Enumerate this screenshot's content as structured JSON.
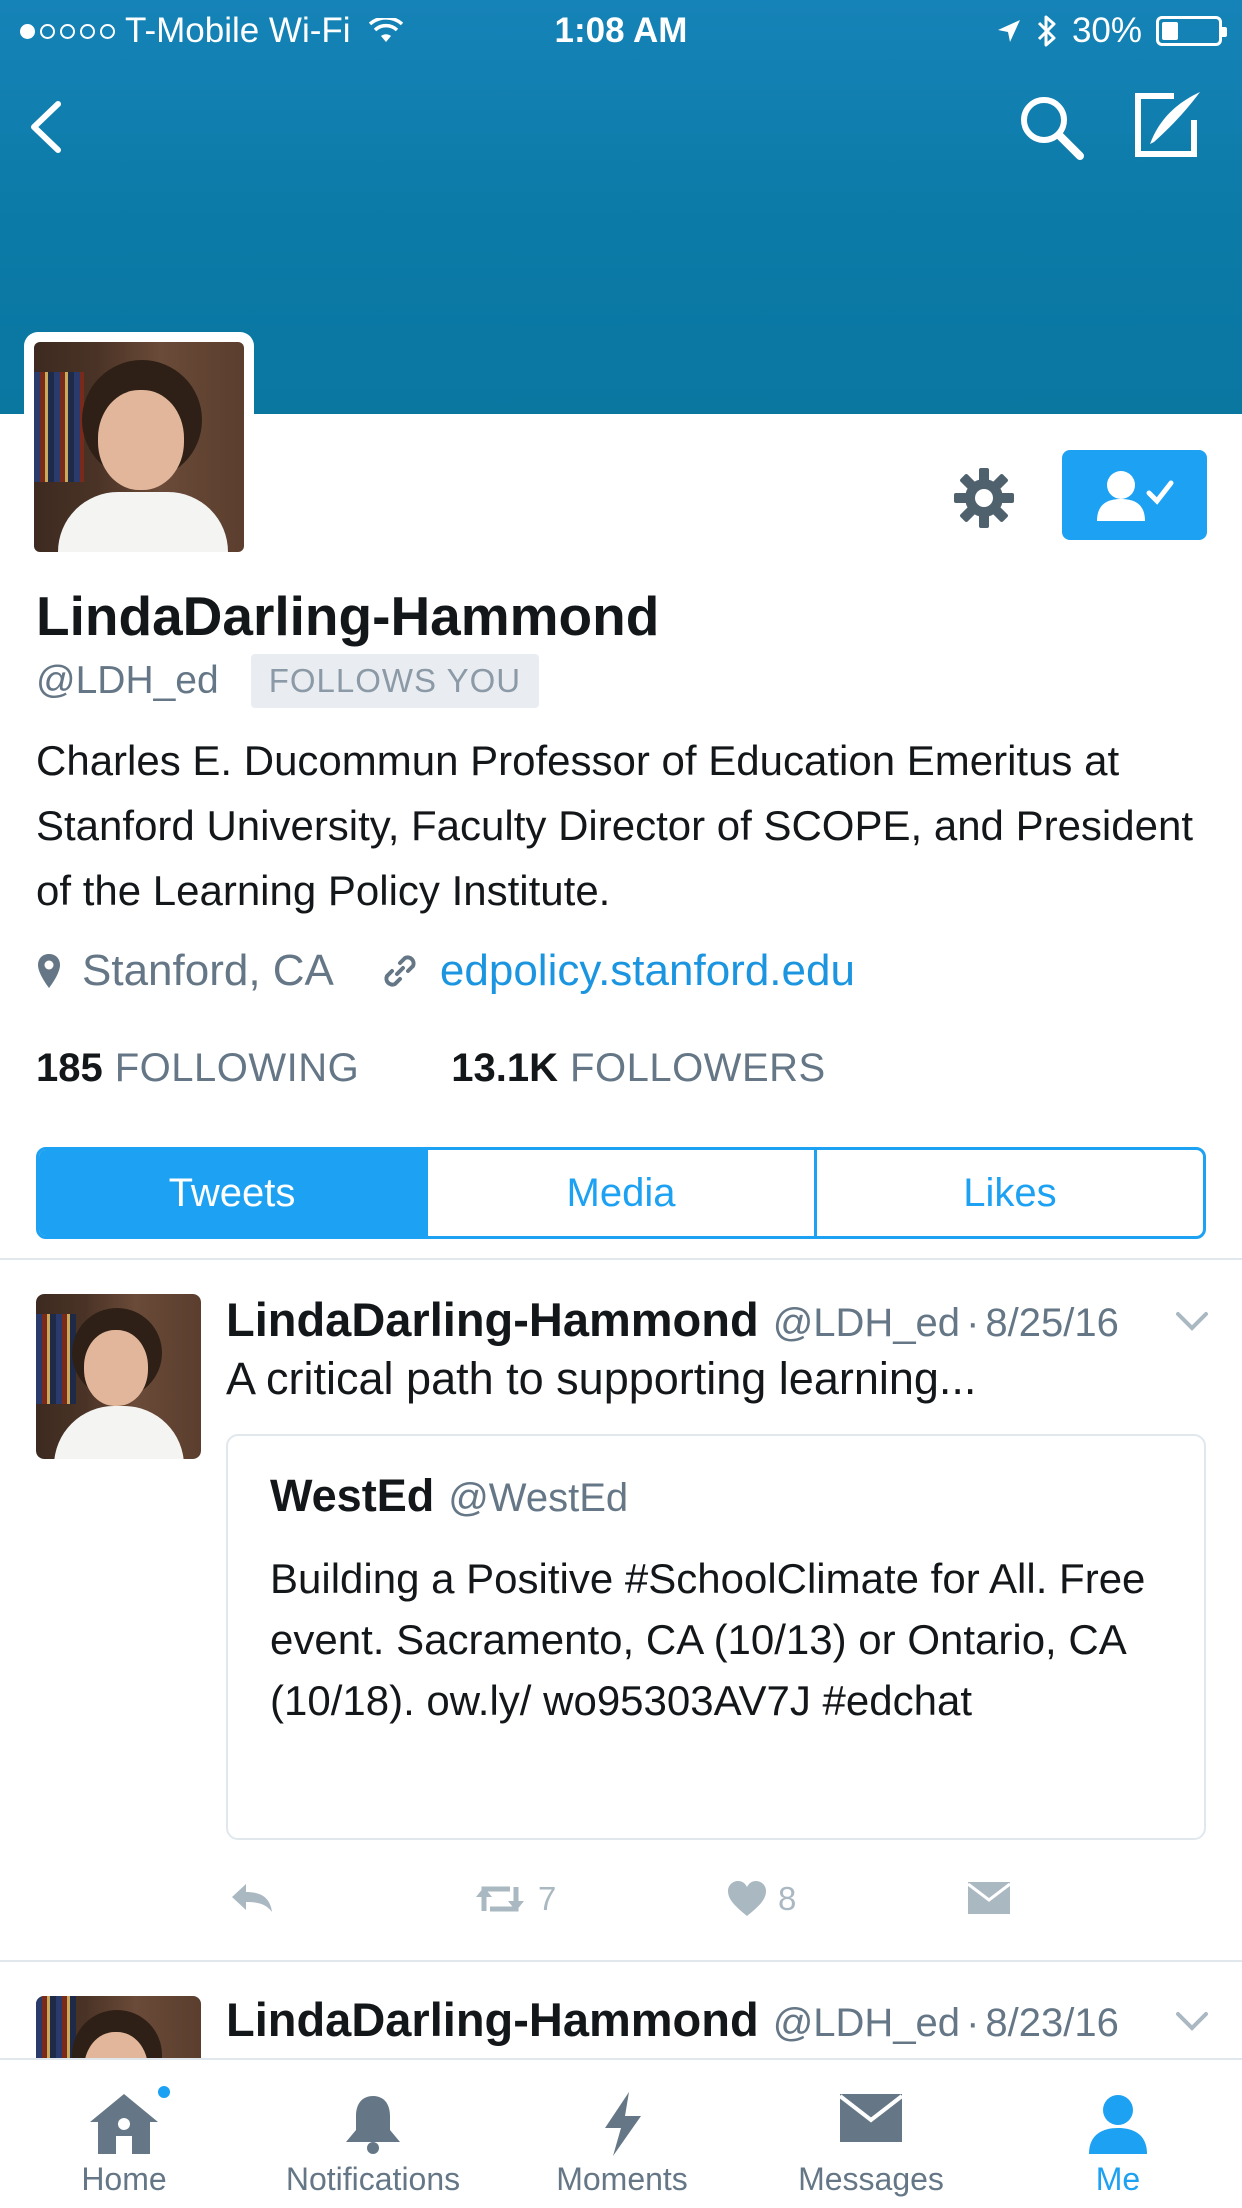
{
  "status_bar": {
    "carrier": "T-Mobile Wi-Fi",
    "time": "1:08 AM",
    "battery": "30%",
    "battery_level": 0.3,
    "signal_bars_filled": 1,
    "signal_bars_total": 5
  },
  "nav": {
    "back_icon": "chevron-left-icon",
    "search_icon": "search-icon",
    "compose_icon": "compose-icon"
  },
  "colors": {
    "header": "#0b7aa6",
    "accent": "#1da1f2",
    "link": "#1b95e0",
    "secondary_text": "#657786"
  },
  "profile": {
    "name": "LindaDarling-Hammond",
    "handle": "@LDH_ed",
    "follows_you": "FOLLOWS YOU",
    "bio": "Charles E. Ducommun Professor of Education Emeritus at Stanford University, Faculty Director of SCOPE, and President of the Learning Policy Institute.",
    "location": "Stanford, CA",
    "website": "edpolicy.stanford.edu",
    "following_count": "185",
    "following_label": "FOLLOWING",
    "followers_count": "13.1K",
    "followers_label": "FOLLOWERS"
  },
  "tabs": [
    {
      "label": "Tweets",
      "active": true
    },
    {
      "label": "Media",
      "active": false
    },
    {
      "label": "Likes",
      "active": false
    }
  ],
  "tweets": [
    {
      "name": "LindaDarling-Hammond",
      "handle": "@LDH_ed",
      "date": "8/25/16",
      "text": "A critical path to supporting learning...",
      "quoted": {
        "name": "WestEd",
        "handle": "@WestEd",
        "text": "Building a Positive #SchoolClimate for All. Free event. Sacramento, CA (10/13) or Ontario, CA (10/18). ow.ly/ wo95303AV7J #edchat"
      },
      "retweets": "7",
      "likes": "8"
    },
    {
      "name": "LindaDarling-Hammond",
      "handle": "@LDH_ed",
      "date": "8/23/16"
    }
  ],
  "tabbar": [
    {
      "label": "Home",
      "icon": "home-icon",
      "active": false,
      "badge": true
    },
    {
      "label": "Notifications",
      "icon": "bell-icon",
      "active": false
    },
    {
      "label": "Moments",
      "icon": "lightning-icon",
      "active": false
    },
    {
      "label": "Messages",
      "icon": "envelope-icon",
      "active": false
    },
    {
      "label": "Me",
      "icon": "person-icon",
      "active": true
    }
  ]
}
